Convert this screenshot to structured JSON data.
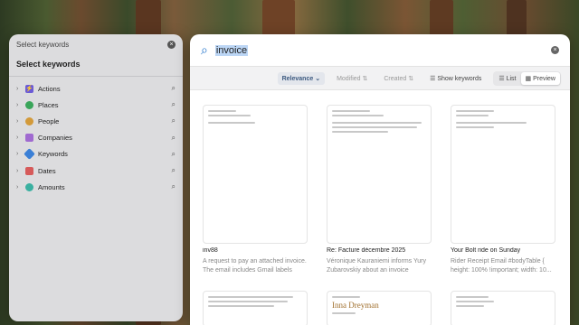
{
  "sidebar": {
    "header": "Select keywords",
    "title": "Select keywords",
    "items": [
      {
        "label": "Actions",
        "icon": "lightning-icon",
        "color": "#6b5bd6"
      },
      {
        "label": "Places",
        "icon": "globe-icon",
        "color": "#3aa55a"
      },
      {
        "label": "People",
        "icon": "person-icon",
        "color": "#d39a3a"
      },
      {
        "label": "Companies",
        "icon": "building-icon",
        "color": "#a06ad0"
      },
      {
        "label": "Keywords",
        "icon": "tag-icon",
        "color": "#3a7fd6"
      },
      {
        "label": "Dates",
        "icon": "calendar-icon",
        "color": "#d65a5a"
      },
      {
        "label": "Amounts",
        "icon": "coin-icon",
        "color": "#3ab0a0"
      }
    ]
  },
  "search": {
    "query": "invoice"
  },
  "toolbar": {
    "relevance": "Relevance",
    "modified": "Modified",
    "created": "Created",
    "show_keywords": "Show keywords",
    "list": "List",
    "preview": "Preview"
  },
  "cards": [
    {
      "title": "inv88",
      "desc": "A request to pay an attached invoice. The email includes Gmail labels indic..."
    },
    {
      "title": "Re: Facture décembre 2025",
      "desc": "Véronique Kauraniemi informs Yury Zubarovskiy about an invoice payme..."
    },
    {
      "title": "Your Bolt ride on Sunday",
      "desc": "Rider Receipt Email #bodyTable { height: 100% !important; width: 10..."
    }
  ],
  "second_row_name": "Inna Dreyman"
}
